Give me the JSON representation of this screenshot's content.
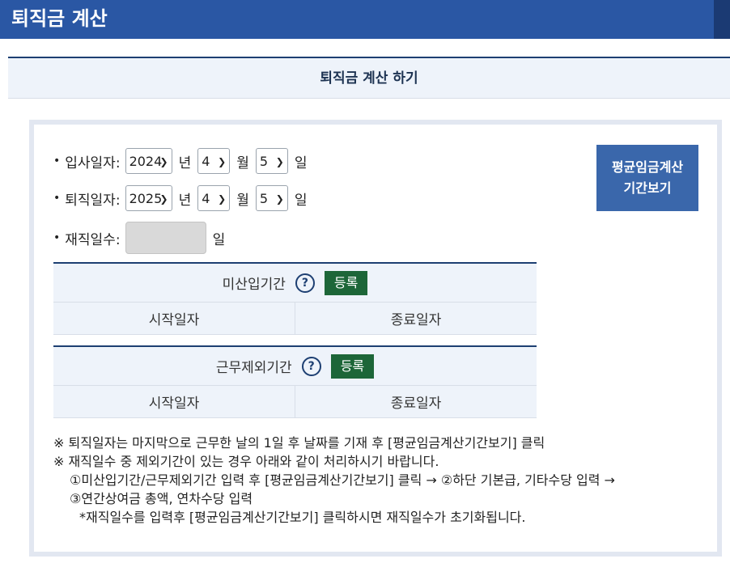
{
  "header": {
    "title": "퇴직금 계산"
  },
  "section": {
    "title": "퇴직금 계산 하기"
  },
  "form": {
    "start_date": {
      "label": "입사일자:",
      "year": "2024",
      "month": "4",
      "day": "5"
    },
    "end_date": {
      "label": "퇴직일자:",
      "year": "2025",
      "month": "4",
      "day": "5"
    },
    "days": {
      "label": "재직일수:",
      "value": "",
      "unit": "일"
    },
    "units": {
      "year": "년",
      "month": "월",
      "day": "일"
    },
    "bullet": "•"
  },
  "avg_button": {
    "line1": "평균임금계산",
    "line2": "기간보기"
  },
  "excluded_table1": {
    "title": "미산입기간",
    "help": "?",
    "register": "등록",
    "col_start": "시작일자",
    "col_end": "종료일자"
  },
  "excluded_table2": {
    "title": "근무제외기간",
    "help": "?",
    "register": "등록",
    "col_start": "시작일자",
    "col_end": "종료일자"
  },
  "notes": {
    "line1": "※ 퇴직일자는 마지막으로 근무한 날의 1일 후 날짜를 기재 후 [평균임금계산기간보기] 클릭",
    "line2": "※ 재직일수 중 제외기간이 있는 경우 아래와 같이 처리하시기 바랍니다.",
    "line3": "①미산입기간/근무제외기간 입력 후 [평균임금계산기간보기] 클릭 → ②하단 기본급, 기타수당 입력 →",
    "line4": "③연간상여금 총액, 연차수당 입력",
    "line5": "*재직일수를 입력후 [평균임금계산기간보기] 클릭하시면 재직일수가 초기화됩니다."
  },
  "icons": {
    "chevron": "chevron-down-icon"
  }
}
